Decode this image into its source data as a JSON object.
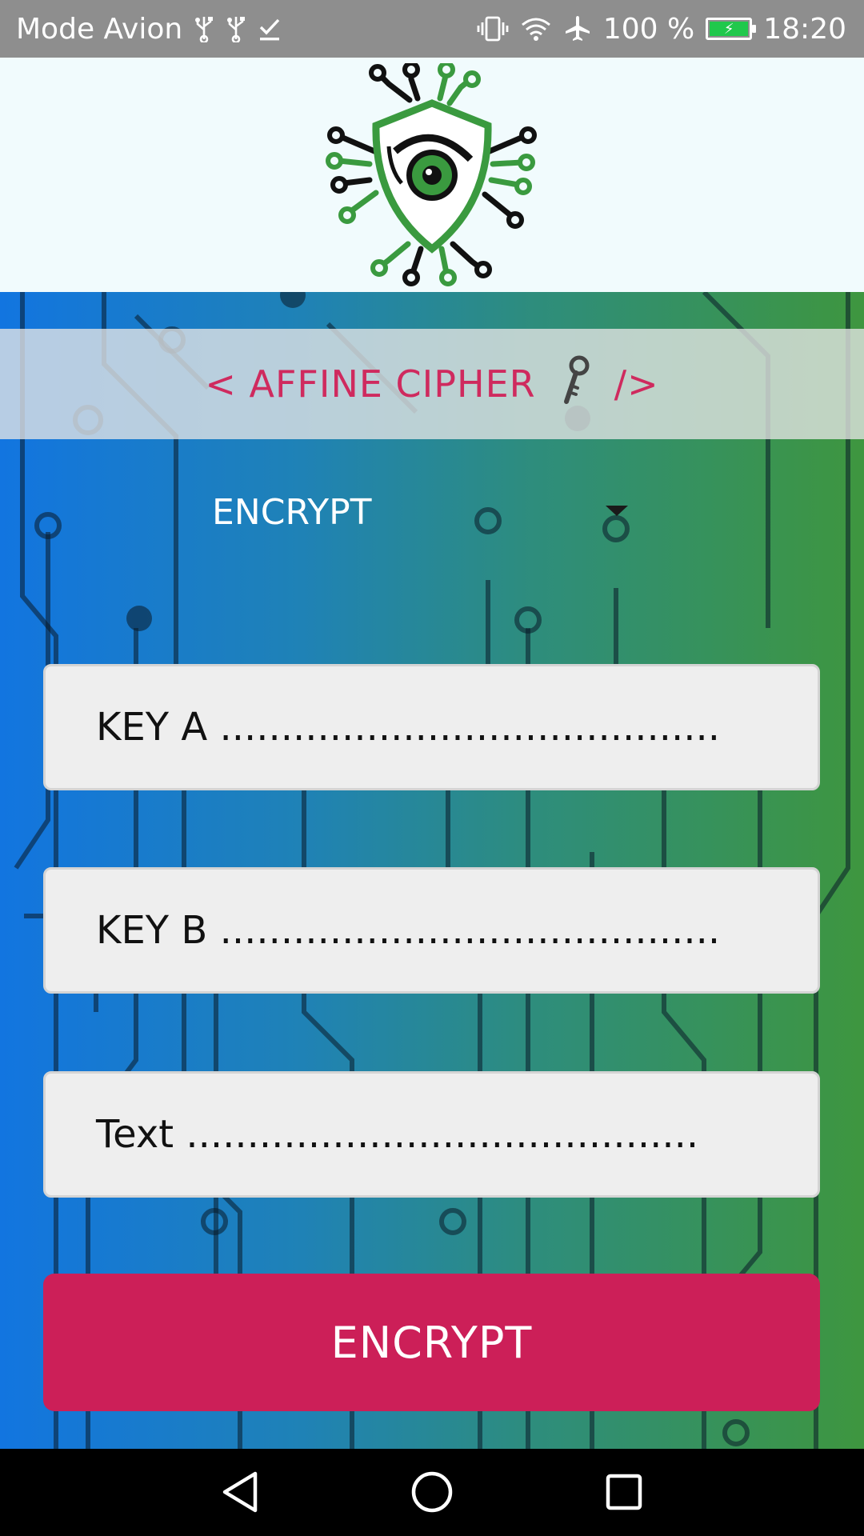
{
  "status_bar": {
    "mode_label": "Mode Avion",
    "battery_percent": "100 %",
    "battery_level": 1.0,
    "time": "18:20",
    "icons": [
      "usb-icon",
      "usb-icon",
      "download-done-icon",
      "vibrate-icon",
      "wifi-icon",
      "airplane-icon",
      "battery-charging-icon"
    ]
  },
  "header": {
    "logo": "eye-shield-circuit-logo"
  },
  "banner": {
    "open": "< AFFINE CIPHER",
    "icon": "key-icon",
    "close": "/>"
  },
  "mode_select": {
    "selected": "ENCRYPT"
  },
  "fields": {
    "key_a": "KEY A .........................................",
    "key_b": "KEY B .........................................",
    "text": "Text .........................................."
  },
  "actions": {
    "encrypt_label": "ENCRYPT"
  },
  "colors": {
    "accent": "#cc1f58",
    "title": "#cf2a5e",
    "logo_green": "#3a9a3f",
    "gradient_start": "#1275e0",
    "gradient_end": "#3e963f"
  }
}
